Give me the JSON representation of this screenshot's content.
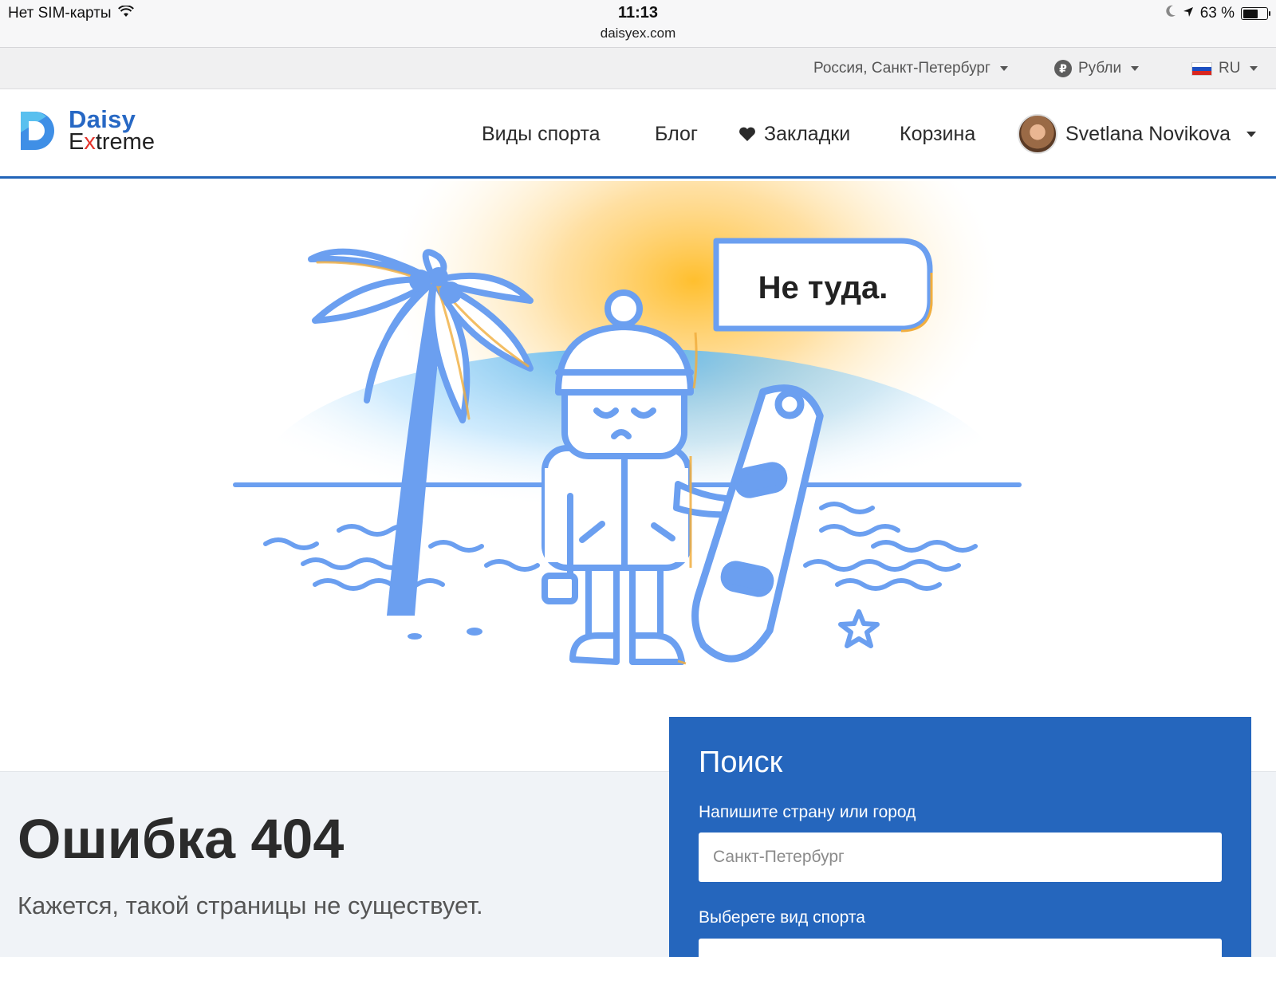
{
  "status_bar": {
    "carrier": "Нет SIM-карты",
    "time": "11:13",
    "url": "daisyex.com",
    "battery": "63 %",
    "battery_level": 0.63
  },
  "util_bar": {
    "location": "Россия, Санкт-Петербург",
    "currency_symbol": "₽",
    "currency": "Рубли",
    "language": "RU"
  },
  "header": {
    "logo_line1": "Daisy",
    "logo_line2_a": "E",
    "logo_line2_x": "x",
    "logo_line2_b": "treme",
    "nav": {
      "sports": "Виды спорта",
      "blog": "Блог",
      "bookmarks": "Закладки",
      "cart": "Корзина",
      "user": "Svetlana Novikova"
    }
  },
  "hero": {
    "bubble": "Не туда."
  },
  "error": {
    "title": "Ошибка 404",
    "subtitle": "Кажется, такой страницы не существует."
  },
  "search": {
    "title": "Поиск",
    "location_label": "Напишите страну или город",
    "location_placeholder": "Санкт-Петербург",
    "sport_label": "Выберете вид спорта"
  },
  "colors": {
    "brand_blue": "#2566bd",
    "illustration_blue": "#6b9ff0",
    "sun_orange": "#ffbf2e",
    "logo_red": "#e5342c"
  }
}
